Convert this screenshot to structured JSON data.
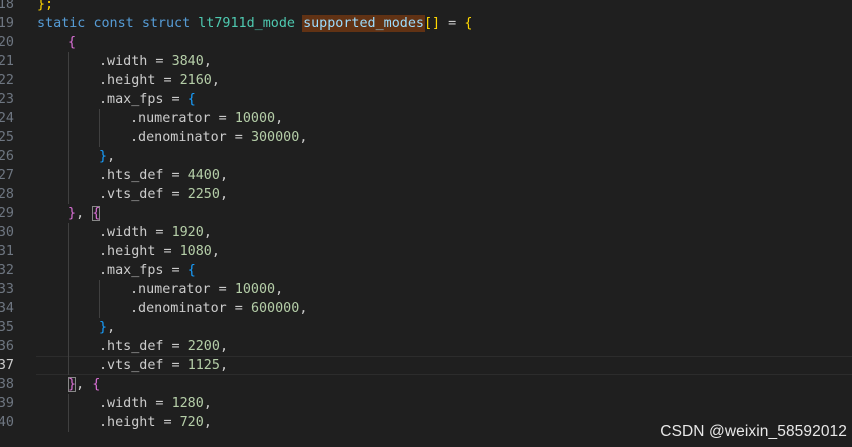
{
  "editor": {
    "line_numbers": [
      "18",
      "19",
      "20",
      "21",
      "22",
      "23",
      "24",
      "25",
      "26",
      "27",
      "28",
      "29",
      "30",
      "31",
      "32",
      "33",
      "34",
      "35",
      "36",
      "37",
      "38",
      "39",
      "40"
    ],
    "active_line": "37",
    "highlighted_word": "supported_modes"
  },
  "code": {
    "l18": {
      "close": "};"
    },
    "l19": {
      "kw_static": "static",
      "kw_const": "const",
      "kw_struct": "struct",
      "type": "lt7911d_mode",
      "var": "supported_modes",
      "brackets": "[]",
      "eq": " = ",
      "open": "{"
    },
    "l20": {
      "open": "{"
    },
    "l21": {
      "field": ".width",
      "eq": " = ",
      "value": "3840",
      "comma": ","
    },
    "l22": {
      "field": ".height",
      "eq": " = ",
      "value": "2160",
      "comma": ","
    },
    "l23": {
      "field": ".max_fps",
      "eq": " = ",
      "open": "{"
    },
    "l24": {
      "field": ".numerator",
      "eq": " = ",
      "value": "10000",
      "comma": ","
    },
    "l25": {
      "field": ".denominator",
      "eq": " = ",
      "value": "300000",
      "comma": ","
    },
    "l26": {
      "close": "}",
      "comma": ","
    },
    "l27": {
      "field": ".hts_def",
      "eq": " = ",
      "value": "4400",
      "comma": ","
    },
    "l28": {
      "field": ".vts_def",
      "eq": " = ",
      "value": "2250",
      "comma": ","
    },
    "l29": {
      "close": "}",
      "sep": ", ",
      "open": "{"
    },
    "l30": {
      "field": ".width",
      "eq": " = ",
      "value": "1920",
      "comma": ","
    },
    "l31": {
      "field": ".height",
      "eq": " = ",
      "value": "1080",
      "comma": ","
    },
    "l32": {
      "field": ".max_fps",
      "eq": " = ",
      "open": "{"
    },
    "l33": {
      "field": ".numerator",
      "eq": " = ",
      "value": "10000",
      "comma": ","
    },
    "l34": {
      "field": ".denominator",
      "eq": " = ",
      "value": "600000",
      "comma": ","
    },
    "l35": {
      "close": "}",
      "comma": ","
    },
    "l36": {
      "field": ".hts_def",
      "eq": " = ",
      "value": "2200",
      "comma": ","
    },
    "l37": {
      "field": ".vts_def",
      "eq": " = ",
      "value": "1125",
      "comma": ","
    },
    "l38": {
      "close": "}",
      "sep": ", ",
      "open": "{"
    },
    "l39": {
      "field": ".width",
      "eq": " = ",
      "value": "1280",
      "comma": ","
    },
    "l40": {
      "field": ".height",
      "eq": " = ",
      "value": "720",
      "comma": ","
    }
  },
  "watermark": "CSDN @weixin_58592012",
  "colors": {
    "background": "#1f1f1f",
    "keyword": "#569cd6",
    "type": "#4ec9b0",
    "variable": "#9cdcfe",
    "number": "#b5cea8",
    "bracket_level1": "#ffd700",
    "bracket_level2": "#da70d6",
    "bracket_level3": "#179fff",
    "word_highlight": "#613214"
  }
}
